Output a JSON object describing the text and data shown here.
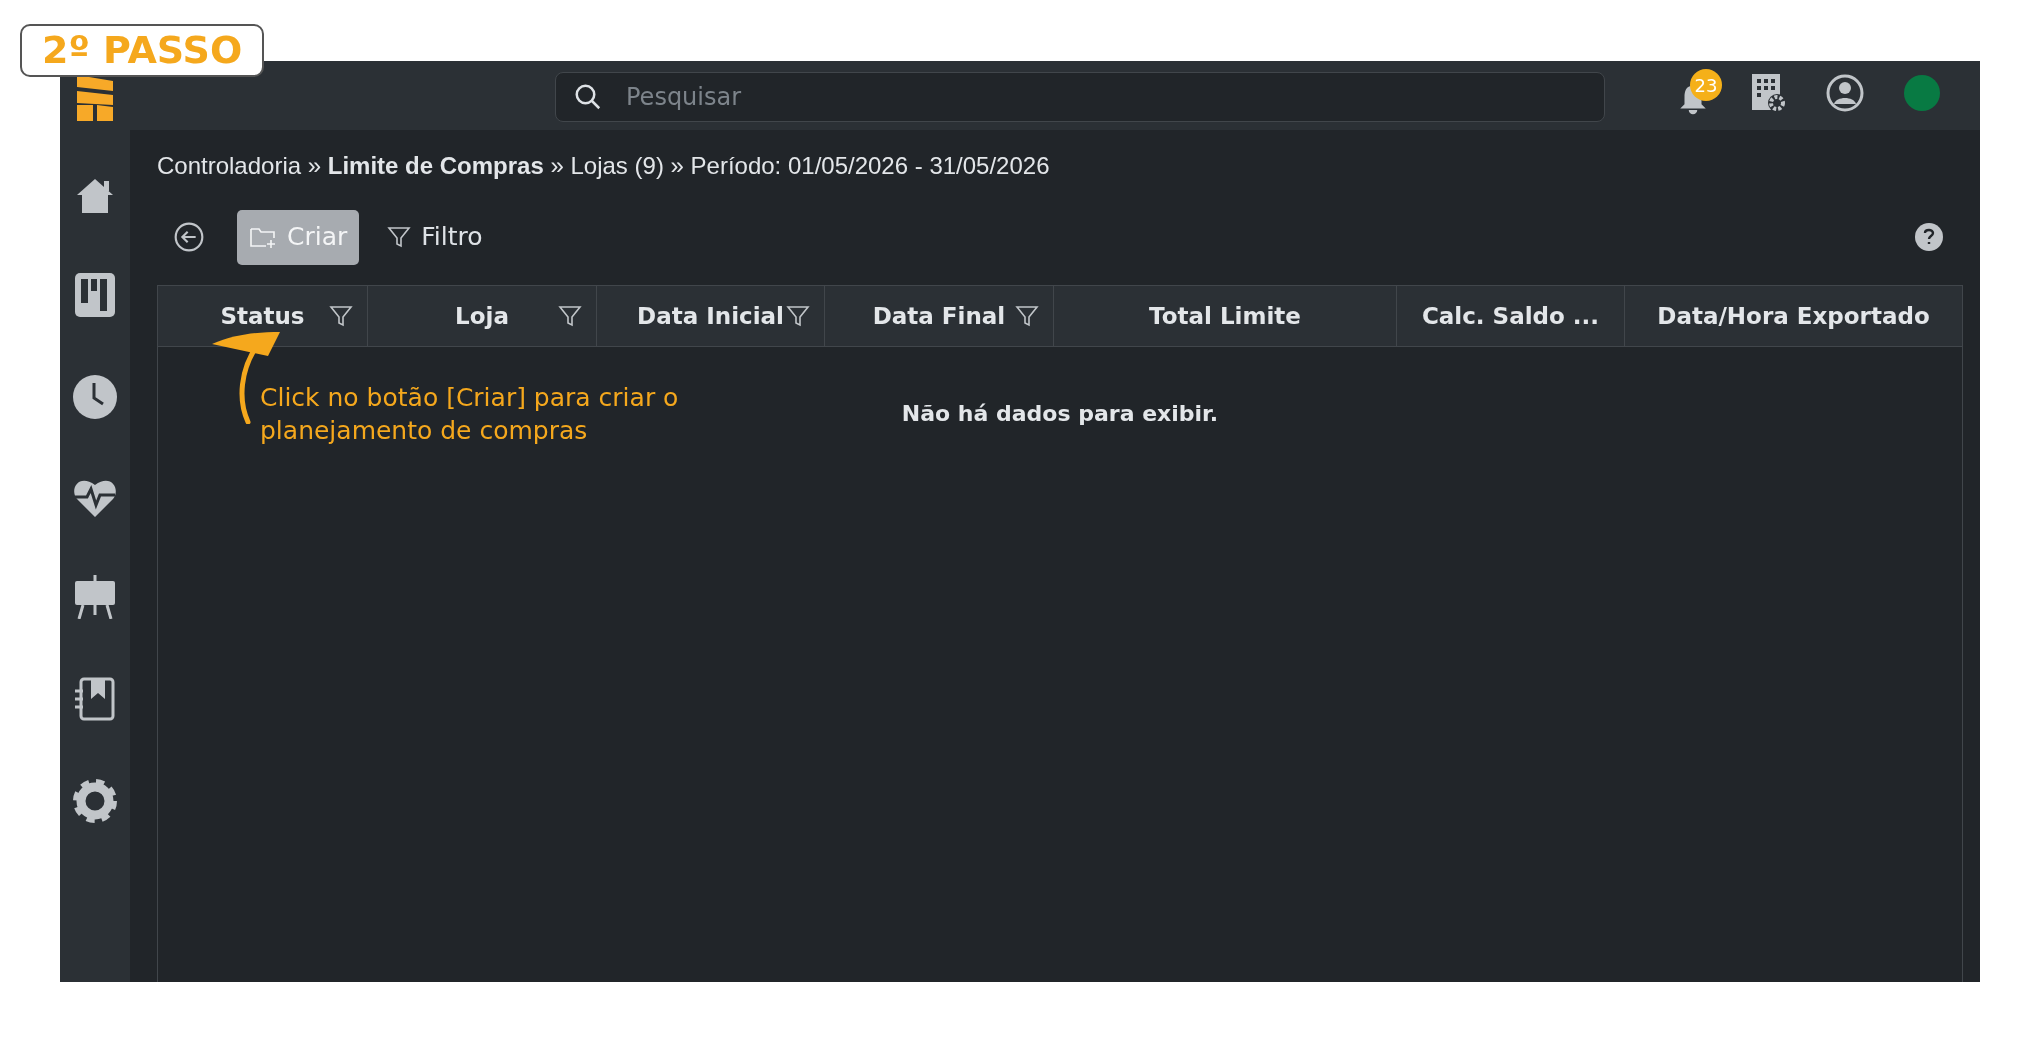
{
  "step_badge": "2º PASSO",
  "search": {
    "placeholder": "Pesquisar"
  },
  "notifications": {
    "count": "23"
  },
  "breadcrumb": "Controladoria » **Limite de Compras** » Lojas (9) » Período: 01/05/2026 - 31/05/2026",
  "toolbar": [
    {
      "kind": "create",
      "label": "Criar",
      "highlighted": true
    },
    {
      "kind": "filter",
      "label": "Filtro",
      "highlighted": false
    }
  ],
  "table": {
    "columns": [
      {
        "label": "Status",
        "filter": true
      },
      {
        "label": "Loja",
        "filter": true
      },
      {
        "label": "Data Inicial",
        "filter": true
      },
      {
        "label": "Data Final",
        "filter": true
      },
      {
        "label": "Total Limite",
        "filter": false
      },
      {
        "label": "Calc. Saldo ...",
        "filter": false
      },
      {
        "label": "Data/Hora Exportado",
        "filter": false
      }
    ],
    "empty_message": "Não há dados para exibir."
  },
  "annotation": "Click no botão [Criar] para criar o planejamento de compras"
}
